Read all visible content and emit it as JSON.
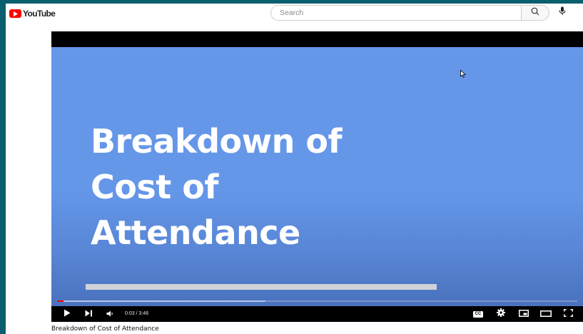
{
  "header": {
    "logo_text": "YouTube",
    "search_placeholder": "Search"
  },
  "player": {
    "slide_title": "Breakdown of\nCost of\nAttendance",
    "current_time": "0:03",
    "duration": "3:46",
    "time_display": "0:03 / 3:46",
    "played_fraction": 0.013,
    "buffered_fraction": 0.4,
    "cc_label": "CC",
    "colors": {
      "accent": "#ff0000",
      "slide_bg": "#6597e9"
    }
  },
  "video": {
    "title": "Breakdown of Cost of Attendance"
  },
  "icons": [
    "youtube-logo-icon",
    "search-icon",
    "mic-icon",
    "play-icon",
    "next-icon",
    "volume-icon",
    "captions-icon",
    "settings-gear-icon",
    "miniplayer-icon",
    "theater-mode-icon",
    "fullscreen-icon",
    "mouse-cursor-icon"
  ]
}
